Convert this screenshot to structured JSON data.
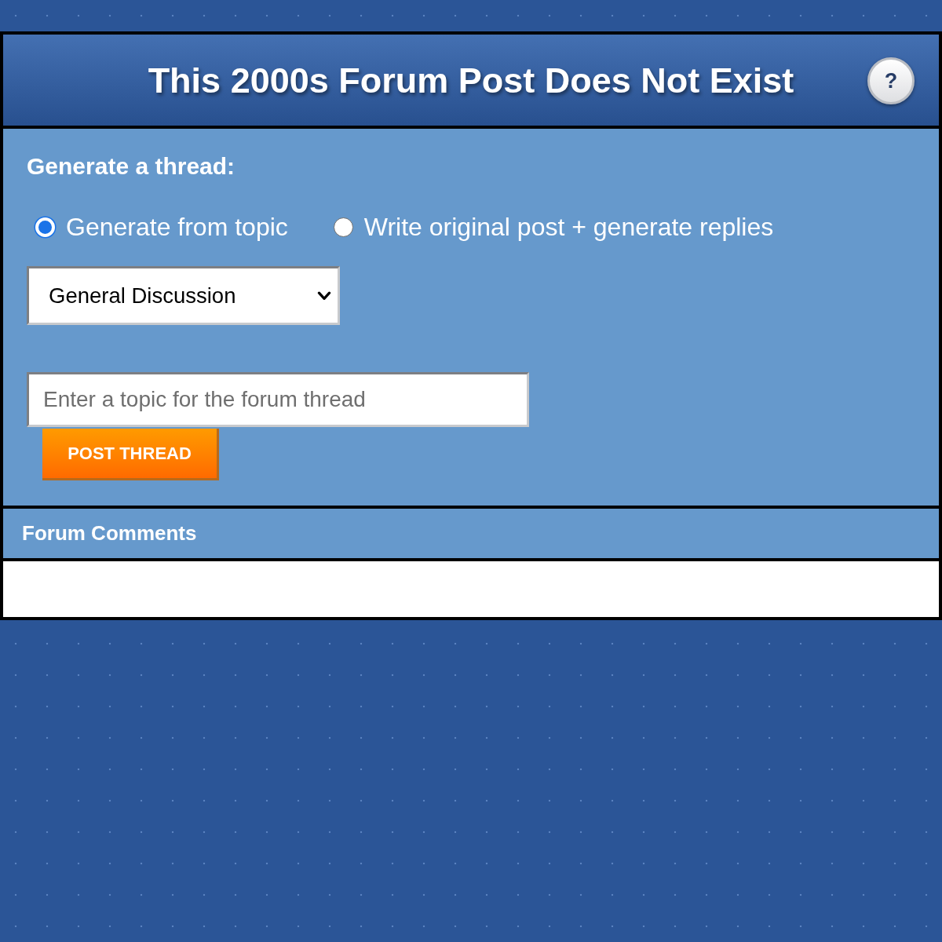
{
  "header": {
    "title": "This 2000s Forum Post Does Not Exist",
    "help_button": "?"
  },
  "generator": {
    "heading": "Generate a thread:",
    "modes": [
      {
        "label": "Generate from topic",
        "selected": true
      },
      {
        "label": "Write original post + generate replies",
        "selected": false
      }
    ],
    "category_select": {
      "value": "General Discussion"
    },
    "topic_field": {
      "placeholder": "Enter a topic for the forum thread"
    },
    "submit_button": "POST THREAD"
  },
  "comments": {
    "title": "Forum Comments"
  }
}
